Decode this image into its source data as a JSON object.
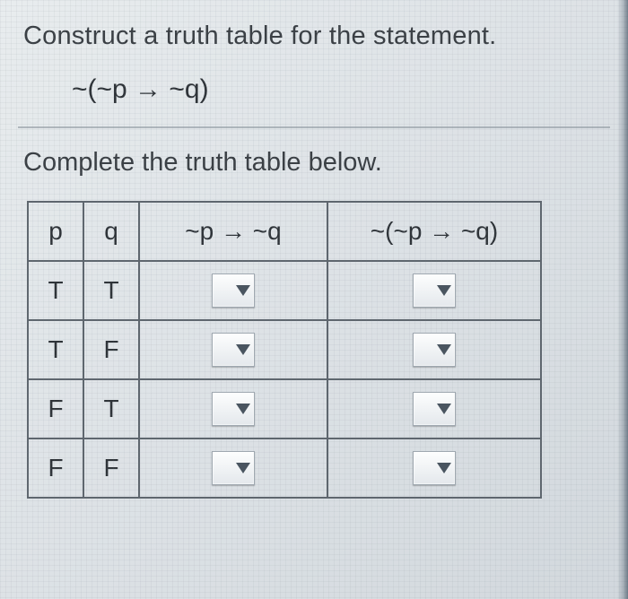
{
  "instruction": "Construct a truth table for the statement.",
  "expression": "~(~p → ~q)",
  "subinstruction": "Complete the truth table below.",
  "headers": {
    "p": "p",
    "q": "q",
    "col3": "~p → ~q",
    "col4": "~(~p → ~q)"
  },
  "rows": [
    {
      "p": "T",
      "q": "T"
    },
    {
      "p": "T",
      "q": "F"
    },
    {
      "p": "F",
      "q": "T"
    },
    {
      "p": "F",
      "q": "F"
    }
  ],
  "chart_data": {
    "type": "table",
    "title": "Truth table for ~(~p → ~q)",
    "columns": [
      "p",
      "q",
      "~p → ~q",
      "~(~p → ~q)"
    ],
    "data": [
      [
        "T",
        "T",
        null,
        null
      ],
      [
        "T",
        "F",
        null,
        null
      ],
      [
        "F",
        "T",
        null,
        null
      ],
      [
        "F",
        "F",
        null,
        null
      ]
    ],
    "note": "Columns 3–4 are dropdown inputs with no selected value shown."
  }
}
